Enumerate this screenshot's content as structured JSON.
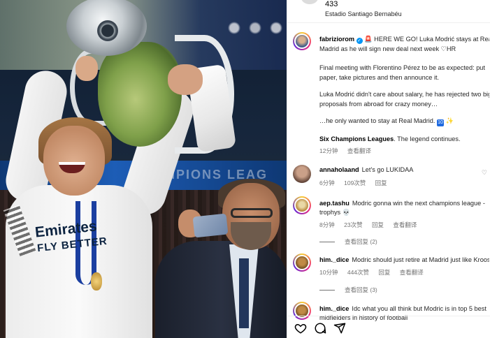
{
  "post": {
    "location_top": "433",
    "location_name": "Estadio Santiago Bernabéu",
    "photo_sponsor_line1": "Emirates",
    "photo_sponsor_line2": "FLY BETTER",
    "photo_banner": "CHAMPIONS LEAG"
  },
  "caption": {
    "username": "fabriziorom",
    "line1": " HERE WE GO! Luka Modrić stays at Real",
    "line2": "Madrid as he will sign new deal next week ♡HR",
    "line3": "Final meeting with Florentino Pérez to be as expected: put",
    "line4": "paper, take pictures and then announce it.",
    "line5": "Luka Modrić didn't care about salary, he has rejected two big",
    "line6": "proposals from abroad for crazy money…",
    "line7": "…he only wanted to stay at Real Madrid.",
    "badge_10": "10",
    "line8_bold": "Six Champions Leagues",
    "line8_rest": ". The legend continues.",
    "time": "12分钟",
    "translate": "查看翻译"
  },
  "comments": [
    {
      "username": "annaholaand",
      "text": "Let's go LUKIDAA",
      "time": "6分钟",
      "likes": "109次赞",
      "reply": "回复"
    },
    {
      "username": "aep.tashu",
      "text": "Modric gonna win the next champions league -",
      "text2": "trophys 💀",
      "time": "8分钟",
      "likes": "23次赞",
      "reply": "回复",
      "translate": "查看翻译",
      "view_replies": "查看回复 (2)"
    },
    {
      "username": "him._dice",
      "text": "Modric should just retire at Madrid just like Kroos",
      "time": "10分钟",
      "likes": "444次赞",
      "reply": "回复",
      "translate": "查看翻译",
      "view_replies": "查看回复 (3)"
    },
    {
      "username": "him._dice",
      "text": "Idc what you all think but Modric is in top 5 best",
      "text2": "midfielders in history of football"
    }
  ],
  "actions": [
    "heart-icon",
    "comment-icon",
    "share-icon"
  ],
  "colors": {
    "verified": "#0095f6",
    "muted": "#737373",
    "text": "#262626"
  }
}
